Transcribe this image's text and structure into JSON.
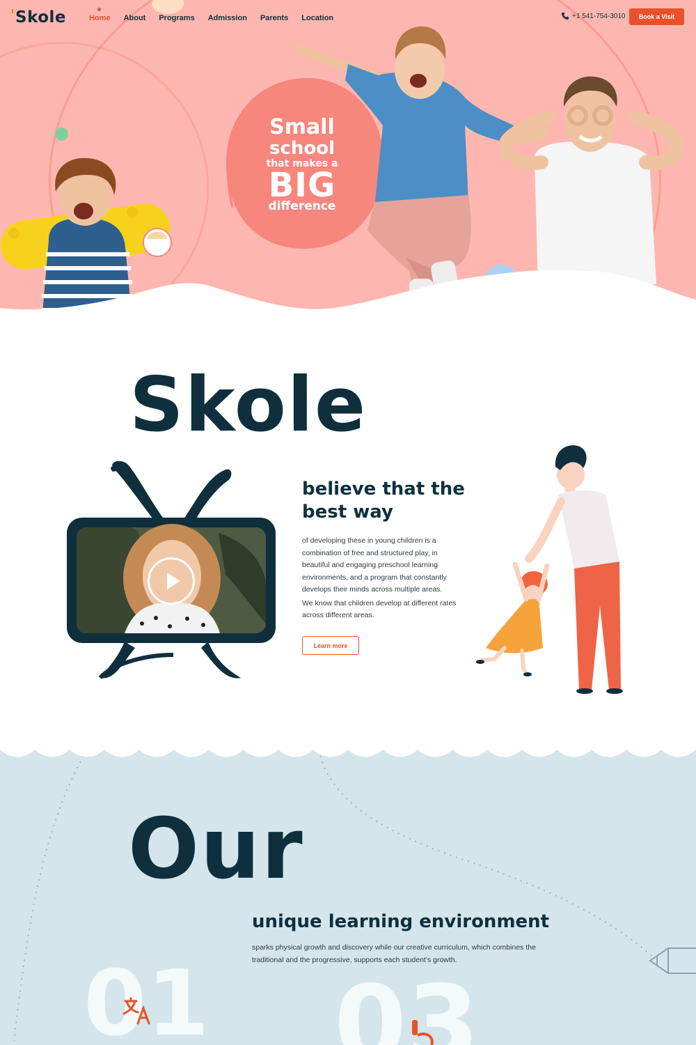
{
  "header": {
    "logo": "Skole",
    "nav": [
      {
        "label": "Home",
        "active": true
      },
      {
        "label": "About"
      },
      {
        "label": "Programs"
      },
      {
        "label": "Admission"
      },
      {
        "label": "Parents"
      },
      {
        "label": "Location"
      }
    ],
    "phone": "+1 541-754-3010",
    "cta": "Book a Visit"
  },
  "hero": {
    "line1": "Small",
    "line2": "school",
    "line3": "that makes a",
    "line4": "BIG",
    "line5": "difference"
  },
  "about": {
    "script_word": "Skole",
    "title": "believe that the best way",
    "paragraph1": "of developing these in young children is a combination of free and structured play, in beautiful and engaging preschool learning environments, and a program that constantly develops their minds across multiple areas.",
    "paragraph2": "We know that children develop at different rates across different areas.",
    "button": "Learn more"
  },
  "environment": {
    "script_word": "Our",
    "title": "unique learning environment",
    "text": "sparks physical growth and discovery while our creative curriculum, which combines the traditional and the progressive, supports each student’s growth.",
    "ghost_numbers": [
      "01",
      "03"
    ]
  },
  "colors": {
    "brand_orange": "#e9512b",
    "navy": "#0f2f3d",
    "hero_pink": "#fdb7b0",
    "blob_coral": "#f7867d",
    "section_blue": "#d4e5ec"
  },
  "icons": [
    "phone-icon",
    "play-icon",
    "translate-icon",
    "pencil-icon"
  ]
}
